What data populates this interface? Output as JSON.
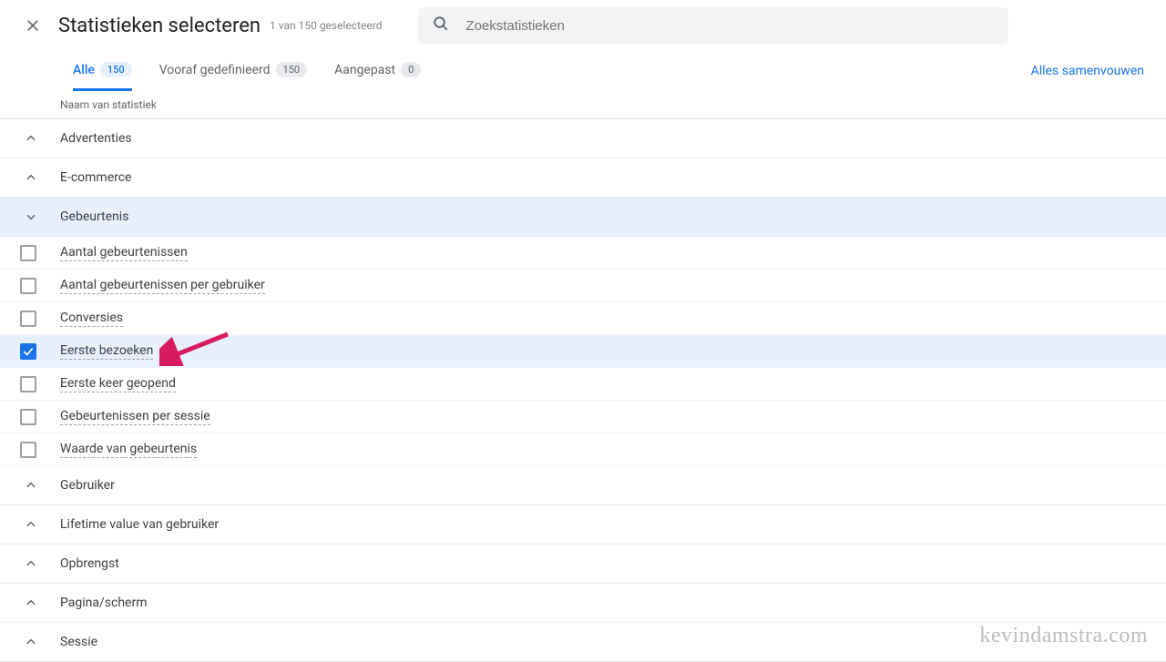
{
  "header": {
    "title": "Statistieken selecteren",
    "subtitle": "1 van 150 geselecteerd",
    "search_placeholder": "Zoekstatistieken"
  },
  "tabs": {
    "all": {
      "label": "Alle",
      "count": "150"
    },
    "predefined": {
      "label": "Vooraf gedefinieerd",
      "count": "150"
    },
    "custom": {
      "label": "Aangepast",
      "count": "0"
    },
    "collapse_all": "Alles samenvouwen"
  },
  "column_header": "Naam van statistiek",
  "sections": {
    "advertenties": "Advertenties",
    "ecommerce": "E-commerce",
    "gebeurtenis": "Gebeurtenis",
    "gebruiker": "Gebruiker",
    "lifetime": "Lifetime value van gebruiker",
    "opbrengst": "Opbrengst",
    "pagina": "Pagina/scherm",
    "sessie": "Sessie"
  },
  "gebeurtenis_items": {
    "i0": "Aantal gebeurtenissen",
    "i1": "Aantal gebeurtenissen per gebruiker",
    "i2": "Conversies",
    "i3": "Eerste bezoeken",
    "i4": "Eerste keer geopend",
    "i5": "Gebeurtenissen per sessie",
    "i6": "Waarde van gebeurtenis"
  },
  "watermark": "kevindamstra.com"
}
